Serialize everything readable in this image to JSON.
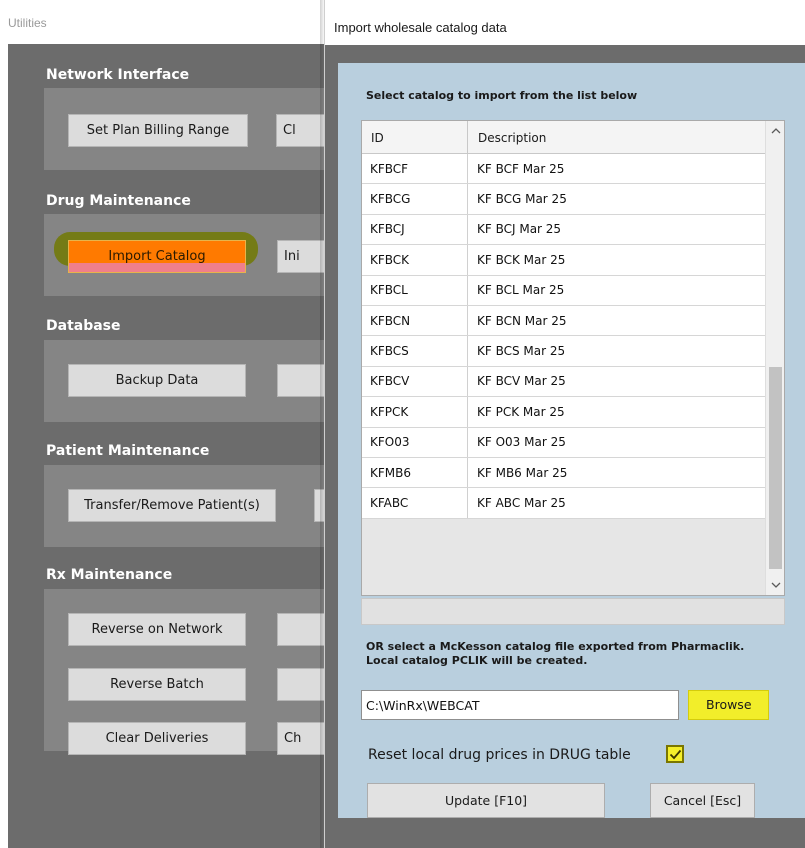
{
  "utilities": {
    "title": "Utilities",
    "sections": {
      "network": {
        "title": "Network Interface",
        "buttons": [
          "Set Plan Billing Range",
          "Cl"
        ]
      },
      "drug": {
        "title": "Drug Maintenance",
        "buttons": [
          "Import Catalog",
          "Ini"
        ]
      },
      "database": {
        "title": "Database",
        "buttons": [
          "Backup Data"
        ]
      },
      "patient": {
        "title": "Patient Maintenance",
        "buttons": [
          "Transfer/Remove Patient(s)"
        ]
      },
      "rx": {
        "title": "Rx Maintenance",
        "buttons": [
          "Reverse on Network",
          "Reverse Batch",
          "Clear Deliveries",
          "Ch"
        ]
      }
    }
  },
  "dialog": {
    "title": "Import wholesale catalog data",
    "list_caption": "Select catalog to import from the list below",
    "columns": {
      "id": "ID",
      "description": "Description"
    },
    "rows": [
      {
        "id": "KFBCF",
        "description": "KF BCF Mar 25"
      },
      {
        "id": "KFBCG",
        "description": "KF BCG Mar 25"
      },
      {
        "id": "KFBCJ",
        "description": "KF BCJ Mar 25"
      },
      {
        "id": "KFBCK",
        "description": "KF BCK Mar 25"
      },
      {
        "id": "KFBCL",
        "description": "KF BCL Mar 25"
      },
      {
        "id": "KFBCN",
        "description": "KF BCN Mar 25"
      },
      {
        "id": "KFBCS",
        "description": "KF BCS Mar 25"
      },
      {
        "id": "KFBCV",
        "description": "KF BCV Mar 25"
      },
      {
        "id": "KFPCK",
        "description": "KF PCK Mar 25"
      },
      {
        "id": "KFO03",
        "description": "KF O03 Mar 25"
      },
      {
        "id": "KFMB6",
        "description": "KF MB6 Mar 25"
      },
      {
        "id": "KFABC",
        "description": "KF ABC Mar 25"
      }
    ],
    "mckesson_text": "OR select a McKesson catalog file exported from Pharmaclik.  Local catalog PCLIK will be created.",
    "path_value": "C:\\WinRx\\WEBCAT",
    "browse_label": "Browse",
    "reset_label": "Reset local drug prices in DRUG table",
    "reset_checked": true,
    "update_label": "Update [F10]",
    "cancel_label": "Cancel [Esc]"
  },
  "icons": {
    "scroll_up": "chevron-up-icon",
    "scroll_down": "chevron-down-icon",
    "checkmark": "checkmark-icon"
  },
  "colors": {
    "import_highlight": "#ff7a00",
    "browse_highlight": "#f2ee2a",
    "dialog_panel": "#b9cfde",
    "dark_background": "#6c6c6c"
  }
}
